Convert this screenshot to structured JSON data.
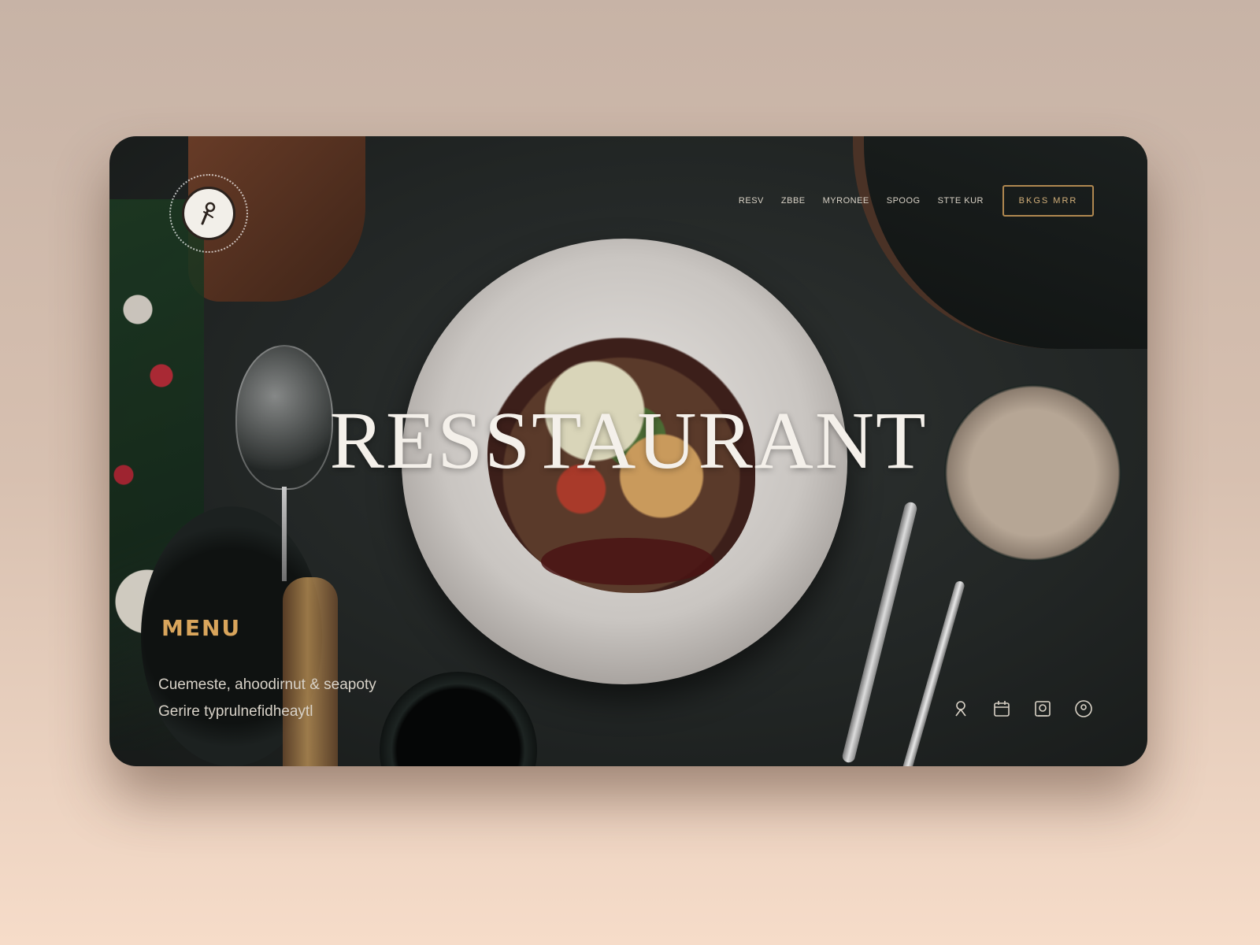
{
  "brand": {
    "logo_icon": "knife-and-fork-emblem"
  },
  "nav": {
    "items": [
      {
        "label": "RESV"
      },
      {
        "label": "ZBBE"
      },
      {
        "label": "MYRONEE"
      },
      {
        "label": "SPOOG"
      },
      {
        "label": "STTE KUR"
      }
    ]
  },
  "cta": {
    "label": "BKGS MRR"
  },
  "hero": {
    "title": "RESSTAURANT"
  },
  "menu": {
    "heading": "MENU",
    "line1": "Cuemeste, ahoodirnut & seapoty",
    "line2": "Gerire typrulnefidheaytl"
  },
  "icons": [
    {
      "name": "chef-icon"
    },
    {
      "name": "calendar-icon"
    },
    {
      "name": "reservation-icon"
    },
    {
      "name": "location-icon"
    }
  ],
  "colors": {
    "accent": "#d9a55c",
    "cta_border": "#b08850",
    "background_top": "#c7b3a6",
    "background_bottom": "#f6dcc9",
    "frame": "#222625"
  }
}
